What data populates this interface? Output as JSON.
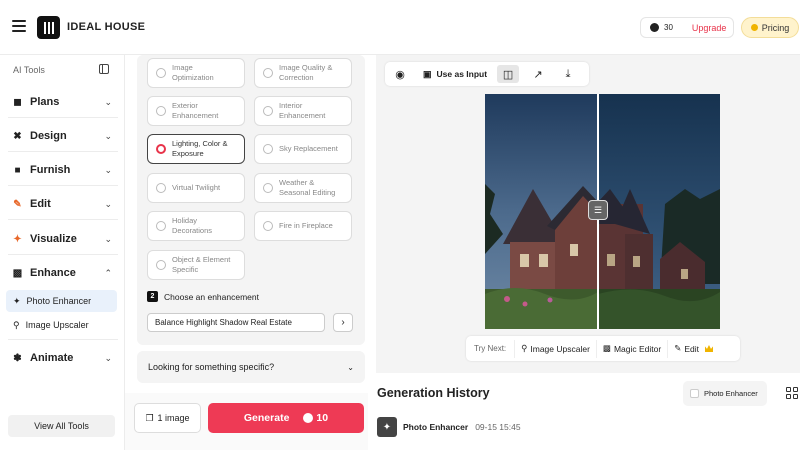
{
  "header": {
    "brand": "IDEAL HOUSE",
    "credits": "30",
    "upgrade_label": "Upgrade",
    "pricing_label": "Pricing"
  },
  "sidebar": {
    "title": "AI Tools",
    "items": [
      {
        "label": "Plans",
        "icon": "plans-icon"
      },
      {
        "label": "Design",
        "icon": "design-icon"
      },
      {
        "label": "Furnish",
        "icon": "furnish-icon"
      },
      {
        "label": "Edit",
        "icon": "edit-icon"
      },
      {
        "label": "Visualize",
        "icon": "visualize-icon"
      },
      {
        "label": "Enhance",
        "icon": "enhance-icon",
        "expanded": true
      },
      {
        "label": "Animate",
        "icon": "animate-icon"
      }
    ],
    "enhance_subitems": [
      {
        "label": "Photo Enhancer",
        "active": true
      },
      {
        "label": "Image Upscaler",
        "active": false
      }
    ],
    "view_all_label": "View All Tools"
  },
  "options": [
    {
      "line1": "Image",
      "line2": "Optimization",
      "selected": false
    },
    {
      "line1": "Image Quality &",
      "line2": "Correction",
      "selected": false
    },
    {
      "line1": "Exterior",
      "line2": "Enhancement",
      "selected": false
    },
    {
      "line1": "Interior",
      "line2": "Enhancement",
      "selected": false
    },
    {
      "line1": "Lighting, Color &",
      "line2": "Exposure",
      "selected": true
    },
    {
      "line1": "Sky Replacement",
      "line2": "",
      "selected": false
    },
    {
      "line1": "Virtual Twilight",
      "line2": "",
      "selected": false
    },
    {
      "line1": "Weather &",
      "line2": "Seasonal Editing",
      "selected": false
    },
    {
      "line1": "Holiday",
      "line2": "Decorations",
      "selected": false
    },
    {
      "line1": "Fire in Fireplace",
      "line2": "",
      "selected": false
    },
    {
      "line1": "Object & Element",
      "line2": "Specific",
      "selected": false
    }
  ],
  "step2": {
    "number": "2",
    "label": "Choose an enhancement",
    "value": "Balance Highlight Shadow Real Estate"
  },
  "looking_label": "Looking for something specific?",
  "bottom": {
    "image_count_label": "1 image",
    "generate_label": "Generate",
    "generate_cost": "10"
  },
  "toolbar": {
    "use_as_input_label": "Use as Input"
  },
  "try_next": {
    "label": "Try Next:",
    "items": [
      {
        "label": "Image Upscaler"
      },
      {
        "label": "Magic Editor"
      },
      {
        "label": "Edit"
      }
    ]
  },
  "history": {
    "title": "Generation History",
    "filter_label": "Photo Enhancer",
    "entries": [
      {
        "name": "Photo Enhancer",
        "date": "09-15 15:45"
      }
    ]
  }
}
